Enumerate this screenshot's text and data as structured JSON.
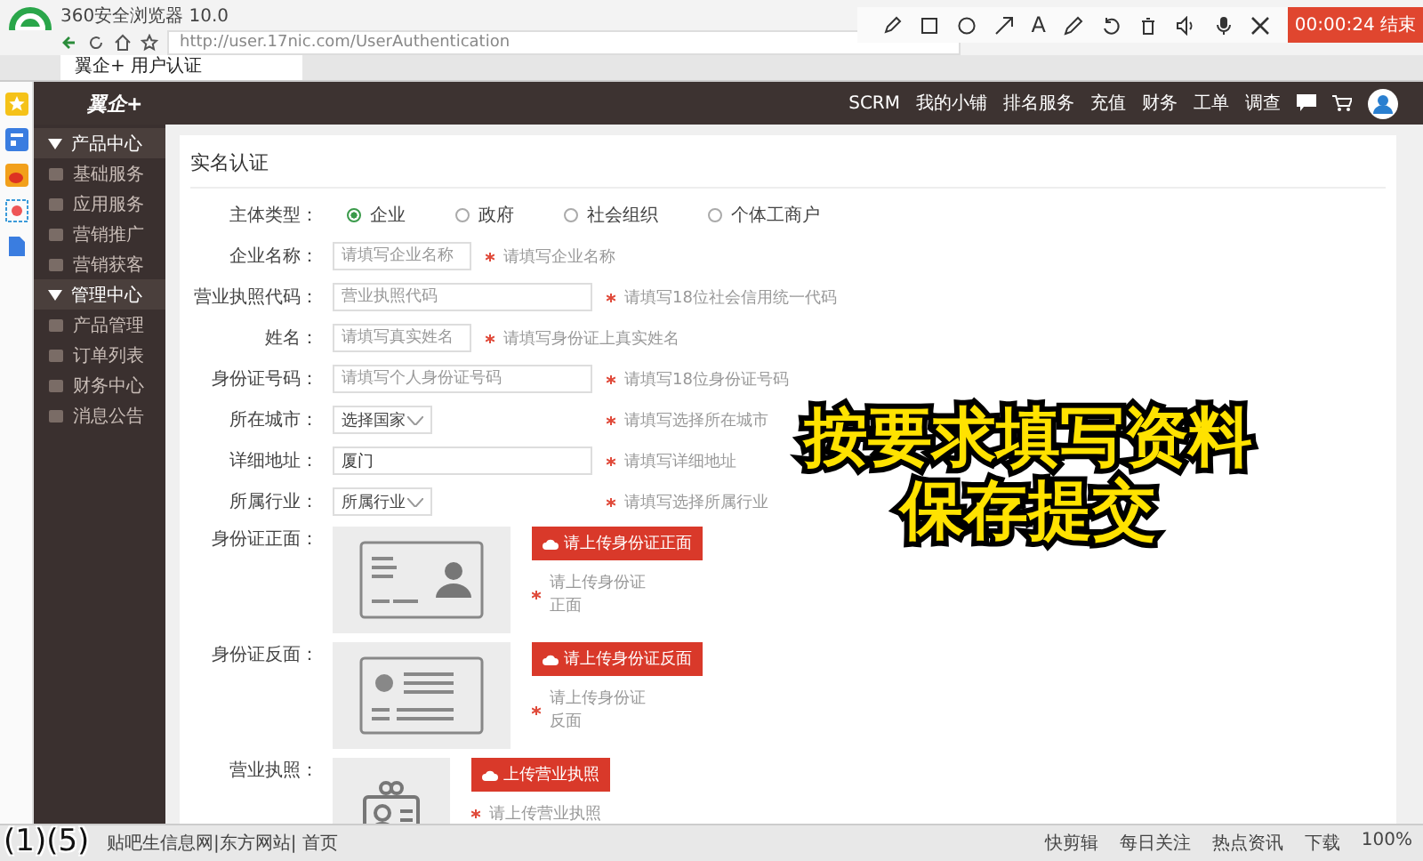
{
  "browser": {
    "title": "360安全浏览器 10.0",
    "url": "http://user.17nic.com/UserAuthentication",
    "tabs": [
      {
        "label": "翼企+ 用户认证",
        "selected": true
      }
    ]
  },
  "recorder": {
    "text_tool": "A",
    "timer": "00:00:24 结束"
  },
  "site": {
    "logo": "翼企+",
    "nav": [
      "SCRM",
      "我的小铺",
      "排名服务",
      "充值",
      "财务",
      "工单",
      "调查"
    ]
  },
  "sidebar": [
    {
      "label": "产品中心",
      "kind": "section",
      "expanded": true
    },
    {
      "label": "基础服务",
      "kind": "item"
    },
    {
      "label": "应用服务",
      "kind": "item"
    },
    {
      "label": "营销推广",
      "kind": "item"
    },
    {
      "label": "营销获客",
      "kind": "item"
    },
    {
      "label": "管理中心",
      "kind": "section",
      "expanded": true
    },
    {
      "label": "产品管理",
      "kind": "item"
    },
    {
      "label": "订单列表",
      "kind": "item"
    },
    {
      "label": "财务中心",
      "kind": "item"
    },
    {
      "label": "消息公告",
      "kind": "item"
    }
  ],
  "form": {
    "title": "实名认证",
    "fields": [
      {
        "kind": "radio",
        "label": "主体类型：",
        "options": [
          {
            "label": "企业",
            "selected": true
          },
          {
            "label": "政府",
            "selected": false
          },
          {
            "label": "社会组织",
            "selected": false
          },
          {
            "label": "个体工商户",
            "selected": false
          }
        ]
      },
      {
        "kind": "short_text",
        "label": "企业名称：",
        "placeholder": "请填写企业名称",
        "hint": "请填写企业名称",
        "required": true
      },
      {
        "kind": "text",
        "label": "营业执照代码：",
        "placeholder": "营业执照代码",
        "hint": "请填写18位社会信用统一代码",
        "required": true
      },
      {
        "kind": "short_text",
        "label": "姓名：",
        "placeholder": "请填写真实姓名",
        "hint": "请填写身份证上真实姓名",
        "required": true
      },
      {
        "kind": "text",
        "label": "身份证号码：",
        "placeholder": "请填写个人身份证号码",
        "hint": "请填写18位身份证号码",
        "required": true
      },
      {
        "kind": "select",
        "label": "所在城市：",
        "value": "选择国家",
        "hint": "请填写选择所在城市",
        "required": true
      },
      {
        "kind": "text",
        "label": "详细地址：",
        "value": "厦门",
        "hint": "请填写详细地址",
        "required": true
      },
      {
        "kind": "select",
        "label": "所属行业：",
        "value": "所属行业",
        "hint": "请填写选择所属行业",
        "required": true
      },
      {
        "kind": "upload",
        "label": "身份证正面：",
        "button": "请上传身份证正面",
        "hint": "请上传身份证正面",
        "required": true
      },
      {
        "kind": "upload",
        "label": "身份证反面：",
        "button": "请上传身份证反面",
        "hint": "请上传身份证反面",
        "required": true
      },
      {
        "kind": "upload",
        "label": "营业执照：",
        "button": "上传营业执照",
        "hint": "请上传营业执照",
        "required": true
      }
    ]
  },
  "caption": [
    "按要求填写资料",
    "保存提交"
  ],
  "subtitle": "(1)(5)",
  "status_bar": {
    "left": "贴吧生信息网|东方网站| 首页",
    "items": [
      "快剪辑",
      "每日关注",
      "热点资讯",
      "下载"
    ],
    "zoom": "100%"
  }
}
